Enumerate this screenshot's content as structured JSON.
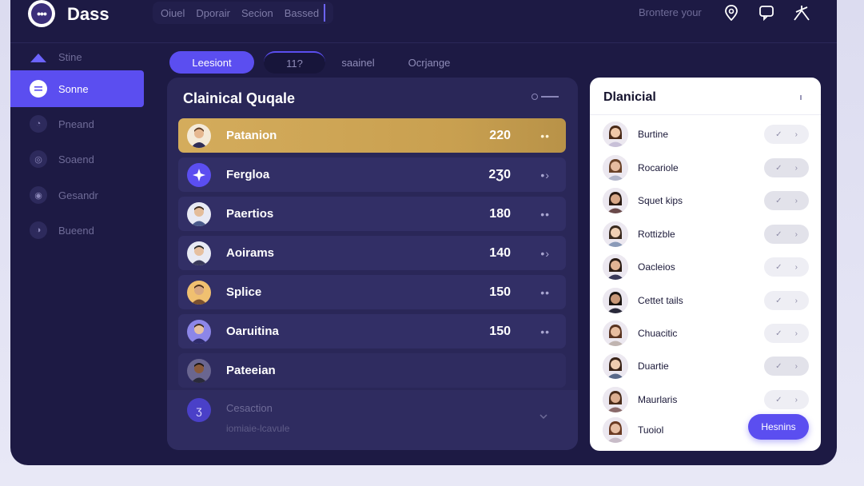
{
  "app": {
    "title": "Dass",
    "logo_icon": "chat-bubble-icon"
  },
  "header": {
    "nav": [
      "Oiuel",
      "Dporair",
      "Secion",
      "Bassed"
    ],
    "right_text": "Brontere your",
    "icons": [
      "location-pin-icon",
      "chat-icon",
      "compass-icon"
    ]
  },
  "sidebar": {
    "items": [
      {
        "label": "Stine",
        "icon": "triangle-icon",
        "active": false
      },
      {
        "label": "Sonne",
        "icon": "list-icon",
        "active": true
      },
      {
        "label": "Pneand",
        "icon": "circle-icon",
        "active": false
      },
      {
        "label": "Soaend",
        "icon": "circle-icon",
        "active": false
      },
      {
        "label": "Gesandr",
        "icon": "circle-icon",
        "active": false
      },
      {
        "label": "Bueend",
        "icon": "circle-icon",
        "active": false
      }
    ]
  },
  "tabs": [
    {
      "label": "Leesiont",
      "style": "active"
    },
    {
      "label": "11?",
      "style": "dark"
    },
    {
      "label": "saainel",
      "style": "plain"
    },
    {
      "label": "Ocrjange",
      "style": "plain"
    }
  ],
  "main": {
    "title": "Clainical Quqale",
    "rows": [
      {
        "name": "Patanion",
        "value": "220",
        "highlight": true,
        "avatar_color": "#f4ead8"
      },
      {
        "name": "Fergloa",
        "value": "2Ʒ0",
        "highlight": false,
        "avatar_color": "#5b4ef0",
        "icon": "sparkle-icon"
      },
      {
        "name": "Paertios",
        "value": "180",
        "highlight": false,
        "avatar_color": "#e8eaf4"
      },
      {
        "name": "Aoirams",
        "value": "140",
        "highlight": false,
        "avatar_color": "#e8eaf4"
      },
      {
        "name": "Splice",
        "value": "150",
        "highlight": false,
        "avatar_color": "#f0c070"
      },
      {
        "name": "Oaruitina",
        "value": "150",
        "highlight": false,
        "avatar_color": "#8c86e8"
      },
      {
        "name": "Pateeian",
        "value": "",
        "highlight": false,
        "avatar_color": "#6a6690"
      }
    ],
    "footer": {
      "title": "Cesaction",
      "subtitle": "iomiaie-lcavule",
      "icon_label": "ʒ"
    }
  },
  "right": {
    "title": "Dlanicial",
    "items": [
      {
        "name": "Burtine",
        "dark": false
      },
      {
        "name": "Rocariole",
        "dark": true
      },
      {
        "name": "Squet kips",
        "dark": true
      },
      {
        "name": "Rottizble",
        "dark": true
      },
      {
        "name": "Oacleios",
        "dark": false
      },
      {
        "name": "Cettet tails",
        "dark": false
      },
      {
        "name": "Chuacitic",
        "dark": false
      },
      {
        "name": "Duartie",
        "dark": true
      },
      {
        "name": "Maurlaris",
        "dark": false
      },
      {
        "name": "Tuoiol",
        "dark": false
      }
    ],
    "button": "Hesnins"
  },
  "colors": {
    "accent": "#5b4ef0",
    "highlight": "#d4ac5c",
    "bg": "#1d1a44",
    "panel": "#2a2758"
  }
}
